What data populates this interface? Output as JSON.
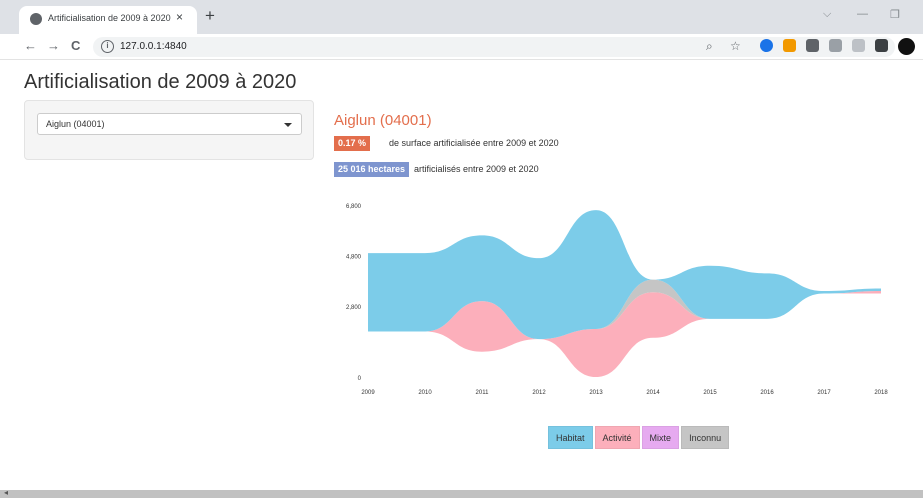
{
  "browser": {
    "tab_title": "Artificialisation de 2009 à 2020",
    "tab_close": "×",
    "new_tab": "+",
    "url": "127.0.0.1:4840",
    "back": "←",
    "forward": "→",
    "reload": "C",
    "minimize": "—",
    "chevron": "⌵",
    "restore": "❐"
  },
  "page": {
    "title": "Artificialisation de 2009 à 2020",
    "select_value": "Aiglun (04001)",
    "commune_heading": "Aiglun (04001)",
    "stat1_badge": "0.17 %",
    "stat1_text": "de surface artificialisée entre 2009 et 2020",
    "stat2_badge": "25 016 hectares",
    "stat2_text": "artificialisés entre 2009 et 2020"
  },
  "colors": {
    "accent_orange": "#e36e4c",
    "badge_blue": "#7e95cf",
    "habitat": "#7ccce9",
    "activite": "#fcafbb",
    "mixte": "#e6aaf0",
    "inconnu": "#c5c5c5"
  },
  "chart_data": {
    "type": "area",
    "subtype": "streamgraph",
    "x": [
      "2009",
      "2010",
      "2011",
      "2012",
      "2013",
      "2014",
      "2015",
      "2016",
      "2017",
      "2018"
    ],
    "y_ticks": [
      "0",
      "2,800",
      "4,800",
      "6,800"
    ],
    "ylim": [
      0,
      7000
    ],
    "baseline": [
      1800,
      1800,
      1000,
      1500,
      0,
      1550,
      2300,
      2300,
      3300,
      3300
    ],
    "series": [
      {
        "name": "Activité",
        "values": [
          0,
          0,
          2000,
          0,
          1900,
          1800,
          0,
          0,
          0,
          100
        ]
      },
      {
        "name": "Mixte",
        "values": [
          0,
          0,
          0,
          0,
          0,
          0,
          0,
          0,
          0,
          0
        ]
      },
      {
        "name": "Inconnu",
        "values": [
          0,
          0,
          0,
          0,
          0,
          500,
          0,
          0,
          0,
          0
        ]
      },
      {
        "name": "Habitat",
        "values": [
          3100,
          3100,
          2600,
          3200,
          4700,
          0,
          2100,
          1800,
          100,
          100
        ]
      }
    ],
    "legend": [
      "Habitat",
      "Activité",
      "Mixte",
      "Inconnu"
    ],
    "legend_position": "bottom-center",
    "grid": false
  }
}
